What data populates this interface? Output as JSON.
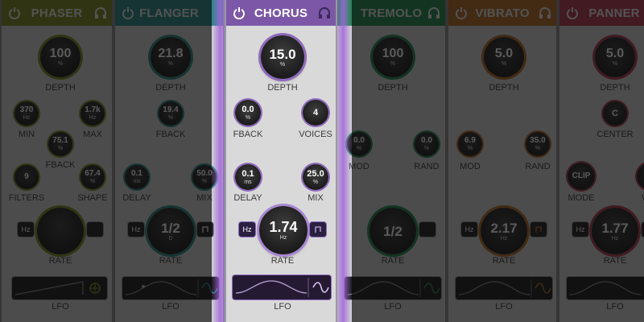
{
  "colors": {
    "phaser": "#7d8a1f",
    "flanger": "#2a8a86",
    "chorus": "#7c57a8",
    "tremolo": "#1f8a4e",
    "vibrato": "#b36a25",
    "panner": "#b33a4f"
  },
  "modules": {
    "phaser": {
      "title": "PHASER",
      "depth": {
        "value": "100",
        "unit": "%",
        "label": "DEPTH"
      },
      "min": {
        "value": "370",
        "unit": "Hz",
        "label": "MIN"
      },
      "max": {
        "value": "1.7k",
        "unit": "Hz",
        "label": "MAX"
      },
      "fback": {
        "value": "75.1",
        "unit": "%",
        "label": "FBACK"
      },
      "filters": {
        "value": "9",
        "label": "FILTERS"
      },
      "shape": {
        "value": "67.4",
        "unit": "%",
        "label": "SHAPE"
      },
      "rate": {
        "label": "RATE"
      },
      "hz": "Hz",
      "lfo": "LFO"
    },
    "flanger": {
      "title": "FLANGER",
      "depth": {
        "value": "21.8",
        "unit": "%",
        "label": "DEPTH"
      },
      "fback": {
        "value": "19.4",
        "unit": "%",
        "label": "FBACK"
      },
      "delay": {
        "value": "0.1",
        "unit": "ms",
        "label": "DELAY"
      },
      "mix": {
        "value": "50.0",
        "unit": "%",
        "label": "MIX"
      },
      "rate": {
        "value": "1/2",
        "unit": "D",
        "label": "RATE"
      },
      "hz": "Hz",
      "lfo": "LFO"
    },
    "chorus": {
      "title": "CHORUS",
      "depth": {
        "value": "15.0",
        "unit": "%",
        "label": "DEPTH"
      },
      "fback": {
        "value": "0.0",
        "unit": "%",
        "label": "FBACK"
      },
      "voices": {
        "value": "4",
        "label": "VOICES"
      },
      "delay": {
        "value": "0.1",
        "unit": "ms",
        "label": "DELAY"
      },
      "mix": {
        "value": "25.0",
        "unit": "%",
        "label": "MIX"
      },
      "rate": {
        "value": "1.74",
        "unit": "Hz",
        "label": "RATE"
      },
      "hz": "Hz",
      "lfo": "LFO"
    },
    "tremolo": {
      "title": "TREMOLO",
      "depth": {
        "value": "100",
        "unit": "%",
        "label": "DEPTH"
      },
      "mod": {
        "value": "0.0",
        "unit": "%",
        "label": "MOD"
      },
      "rand": {
        "value": "0.0",
        "unit": "%",
        "label": "RAND"
      },
      "rate": {
        "value": "1/2",
        "label": "RATE"
      },
      "lfo": "LFO"
    },
    "vibrato": {
      "title": "VIBRATO",
      "depth": {
        "value": "5.0",
        "unit": "%",
        "label": "DEPTH"
      },
      "mod": {
        "value": "6.9",
        "unit": "%",
        "label": "MOD"
      },
      "rand": {
        "value": "35.0",
        "unit": "%",
        "label": "RAND"
      },
      "rate": {
        "value": "2.17",
        "unit": "Hz",
        "label": "RATE"
      },
      "hz": "Hz",
      "lfo": "LFO"
    },
    "panner": {
      "title": "PANNER",
      "depth": {
        "value": "5.0",
        "unit": "%",
        "label": "DEPTH"
      },
      "center": {
        "value": "C",
        "label": "CENTER"
      },
      "mode": {
        "value": "CLIP",
        "label": "MODE"
      },
      "wa": {
        "label": "WA"
      },
      "rate": {
        "value": "1.77",
        "unit": "Hz",
        "label": "RATE"
      },
      "hz": "Hz",
      "lfo": "LFO"
    }
  }
}
